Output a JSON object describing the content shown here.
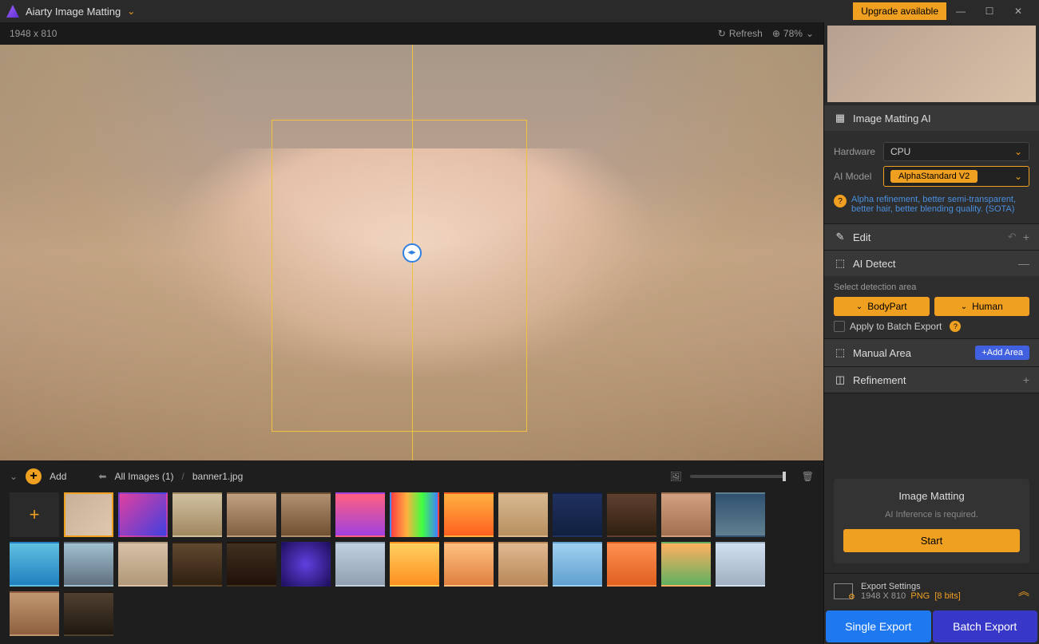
{
  "titlebar": {
    "app_name": "Aiarty Image Matting",
    "upgrade_label": "Upgrade available"
  },
  "canvas_toolbar": {
    "dimensions": "1948 x 810",
    "refresh_label": "Refresh",
    "zoom_value": "78%"
  },
  "filmstrip": {
    "add_label": "Add",
    "breadcrumb_all": "All Images (1)",
    "breadcrumb_sep": "/",
    "current_file": "banner1.jpg"
  },
  "panel": {
    "matting_ai_title": "Image Matting AI",
    "hardware_label": "Hardware",
    "hardware_value": "CPU",
    "model_label": "AI Model",
    "model_value": "AlphaStandard  V2",
    "model_hint": "Alpha refinement, better semi-transparent, better hair, better blending quality. (SOTA)",
    "edit_title": "Edit",
    "detect_title": "AI Detect",
    "detect_hint": "Select detection area",
    "chip_bodypart": "BodyPart",
    "chip_human": "Human",
    "apply_batch_label": "Apply to Batch Export",
    "manual_area_title": "Manual Area",
    "add_area_label": "+Add Area",
    "refinement_title": "Refinement",
    "matting_box_title": "Image Matting",
    "matting_box_hint": "AI Inference is required.",
    "start_label": "Start"
  },
  "export": {
    "settings_title": "Export Settings",
    "dimensions": "1948 X 810",
    "format": "PNG",
    "bits": "[8 bits]",
    "single_label": "Single Export",
    "batch_label": "Batch Export"
  }
}
